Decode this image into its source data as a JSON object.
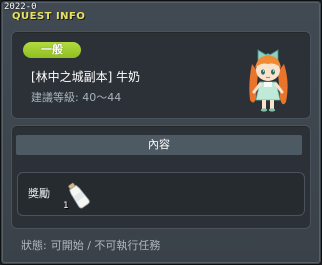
{
  "window": {
    "corner_label": "2022-0",
    "title": "QUEST INFO"
  },
  "quest": {
    "level_badge": "一般",
    "name": "[林中之城副本] 牛奶",
    "recommended_level": "建議等級: 40～44",
    "npc_icon": "npc-girl-portrait"
  },
  "details": {
    "section_title": "內容",
    "reward_label": "獎勵",
    "reward_item": {
      "icon": "milk-bottle-icon",
      "quantity": "1"
    }
  },
  "status": {
    "label": "狀態:",
    "value": "可開始 / 不可執行任務"
  },
  "colors": {
    "title": "#e8e05e",
    "badge": "#9ccb2d",
    "panel": "#2b3137"
  }
}
